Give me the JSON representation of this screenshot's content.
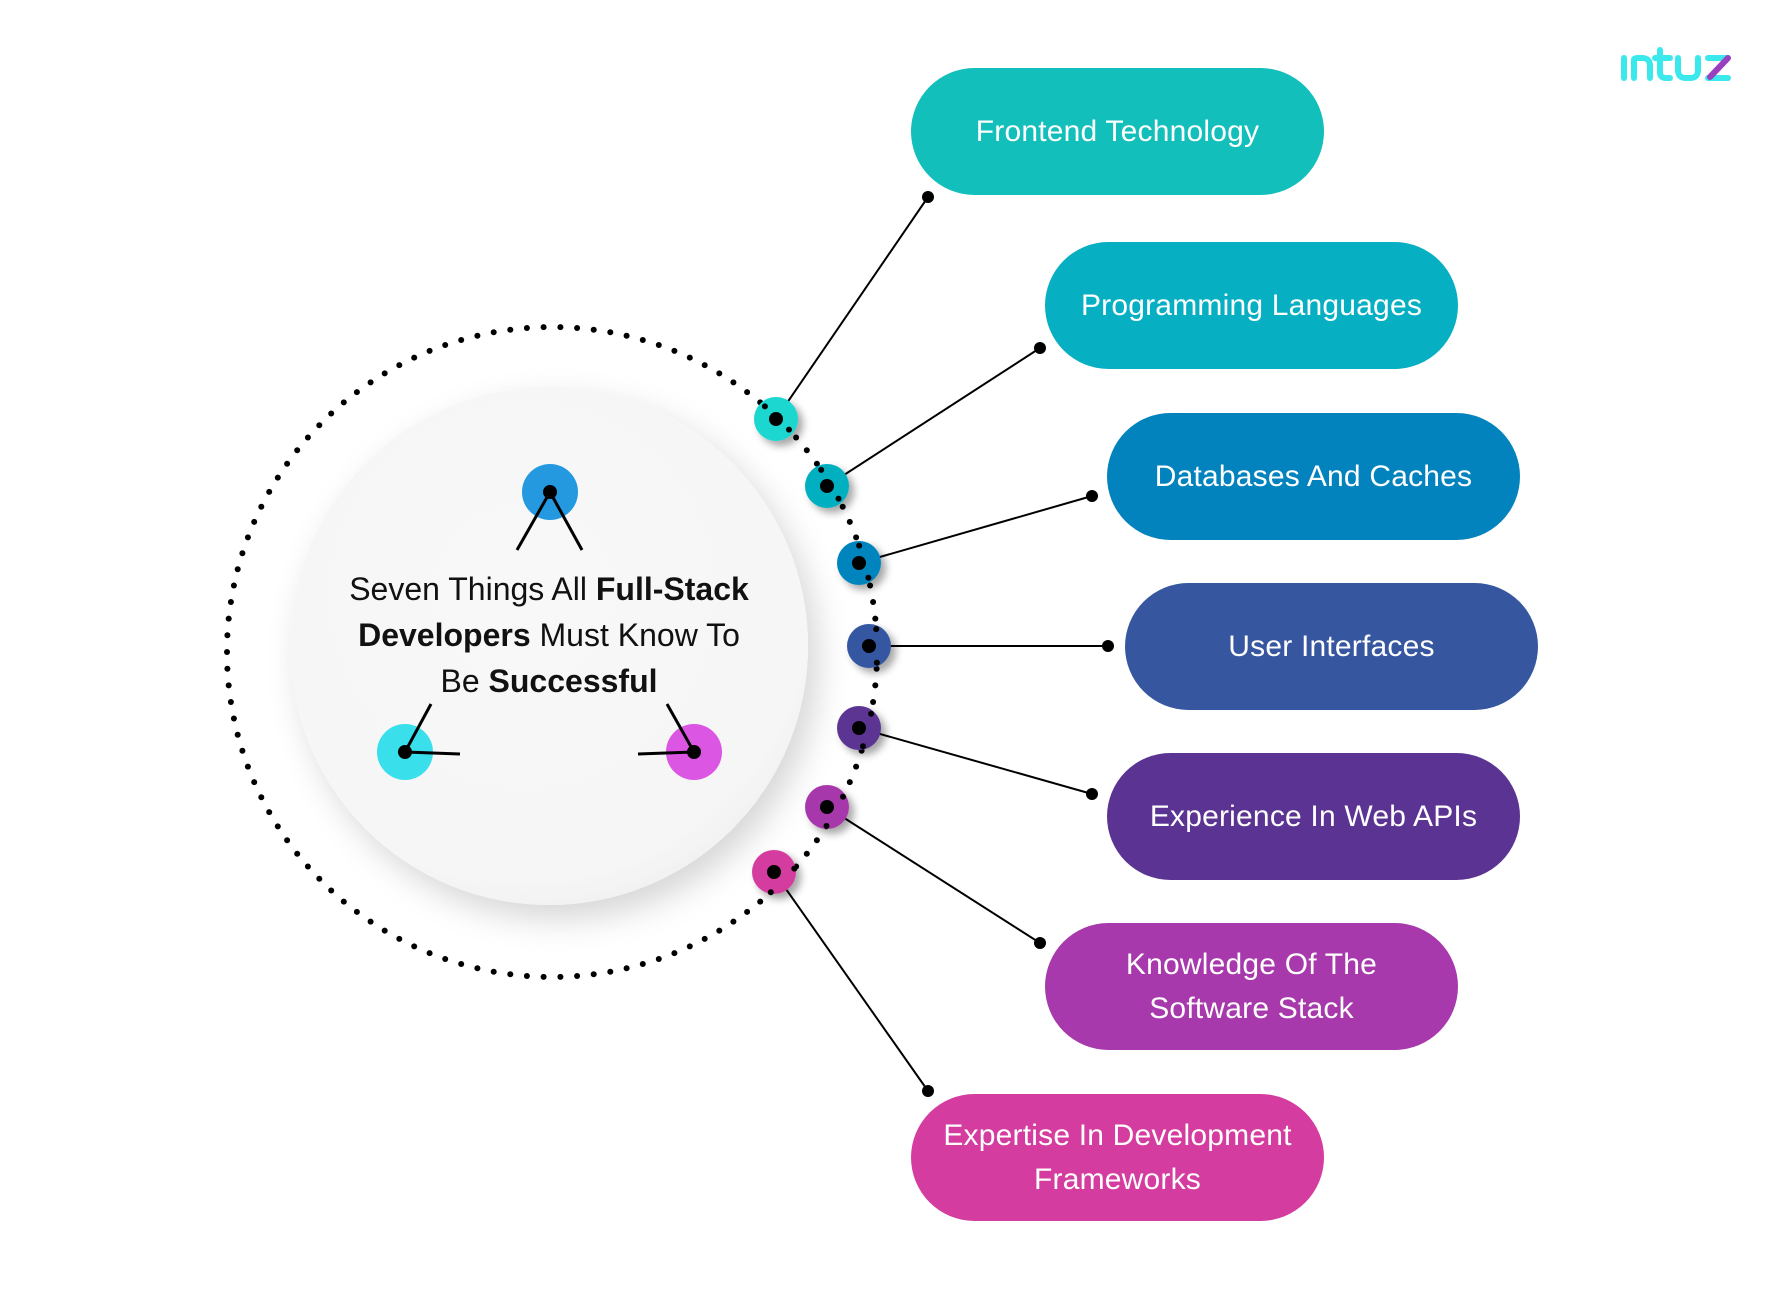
{
  "logo": {
    "text": "intuz",
    "color": "#3BE8EC",
    "accent_color": "#9B3FC1"
  },
  "center": {
    "title_parts": [
      {
        "text": "Seven Things All ",
        "bold": false
      },
      {
        "text": "Full-Stack",
        "bold": true
      },
      {
        "text": " ",
        "bold": false
      },
      {
        "text": "Developers",
        "bold": true
      },
      {
        "text": " Must Know To Be ",
        "bold": false
      },
      {
        "text": "Successful",
        "bold": true
      }
    ],
    "title_line1_regular": "Seven Things All ",
    "title_line1_bold": "Full-Stack",
    "title_line2_bold": "Developers",
    "title_line2_regular": " Must Know To",
    "title_line3_regular": "Be ",
    "title_line3_bold": "Successful",
    "icons": [
      {
        "name": "top-node-icon",
        "color": "#2499E0"
      },
      {
        "name": "left-node-icon",
        "color": "#3ADFEC"
      },
      {
        "name": "right-node-icon",
        "color": "#DB57E3"
      }
    ]
  },
  "items": [
    {
      "label_lines": [
        "Frontend Technology"
      ],
      "color": "#12BFBB",
      "node_color": "#1FD6D0"
    },
    {
      "label_lines": [
        "Programming Languages"
      ],
      "color": "#07AFC2",
      "node_color": "#06AFC0"
    },
    {
      "label_lines": [
        "Databases And Caches"
      ],
      "color": "#0383BD",
      "node_color": "#0484BE"
    },
    {
      "label_lines": [
        "User Interfaces"
      ],
      "color": "#3656A0",
      "node_color": "#3656A0"
    },
    {
      "label_lines": [
        "Experience In Web APIs"
      ],
      "color": "#5B3493",
      "node_color": "#5B3493"
    },
    {
      "label_lines": [
        "Knowledge Of The",
        "Software Stack"
      ],
      "color": "#A739AC",
      "node_color": "#A739AC"
    },
    {
      "label_lines": [
        "Expertise In Development",
        "Frameworks"
      ],
      "color": "#D43D9F",
      "node_color": "#D43D9F"
    }
  ]
}
